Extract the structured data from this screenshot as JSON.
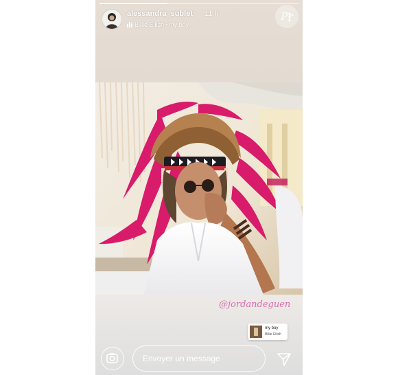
{
  "story": {
    "username": "alessandra_sublet",
    "time": "11 h",
    "music": {
      "artist": "Billie Eilish",
      "separator": "•",
      "song": "my boy"
    },
    "progress": 0.34,
    "logo_mark": "Pr"
  },
  "stickers": {
    "mention": "@jordandeguen",
    "music_sticker": {
      "title": "my boy",
      "artist": "Billie Eilish"
    }
  },
  "footer": {
    "message_placeholder": "Envoyer un message"
  },
  "icons": {
    "camera": "camera-icon",
    "send": "send-icon",
    "more": "more-vertical-icon",
    "music_bars": "music-bars-icon"
  },
  "colors": {
    "mention": "#d96fb0",
    "feathers": "#d81b6a"
  }
}
